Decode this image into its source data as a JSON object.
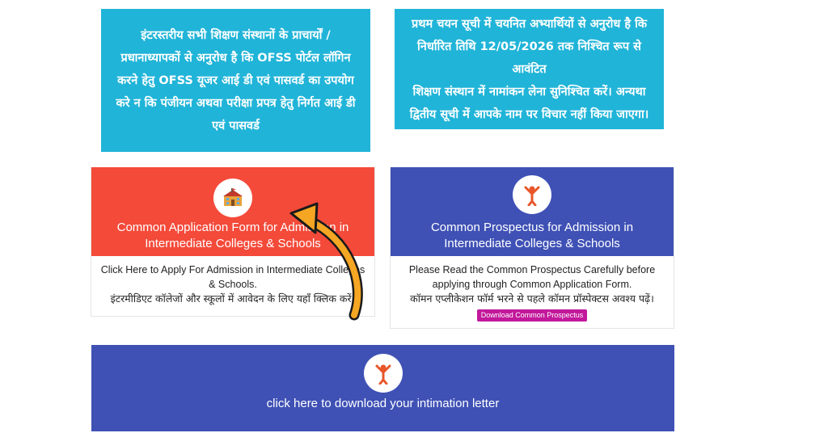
{
  "notices": {
    "left": [
      "इंटरस्तरीय सभी शिक्षण संस्थानों के प्राचार्यों /",
      "प्रधानाध्यापकों से अनुरोध है कि OFSS पोर्टल लॉगिन",
      "करने हेतु OFSS यूजर आई डी एवं पासवर्ड का उपयोग",
      "करे न कि पंजीयन अथवा परीक्षा प्रपत्र हेतु निर्गत आई डी",
      "एवं पासवर्ड"
    ],
    "right": [
      "प्रथम चयन सूची में चयनित अभ्यार्थियों से अनुरोध है कि",
      "निर्धारित तिथि 12/05/2026 तक निश्चित रूप से आवंटित",
      "शिक्षण संस्थान में नामांकन लेना सुनिश्चित करें। अन्यथा",
      "द्वितीय सूची में आपके नाम पर विचार नहीं किया जाएगा।"
    ]
  },
  "apply_card": {
    "title_line1": "Common Application Form for Admission in",
    "title_line2": "Intermediate Colleges & Schools",
    "body_en_line1": "Click Here to Apply For Admission in Intermediate Colleges",
    "body_en_line2": "& Schools.",
    "body_hi": "इंटरमीडिएट कॉलेजों और स्कूलों में आवेदन के लिए यहाँ क्लिक करें।",
    "icon": "school-building-icon"
  },
  "prospectus_card": {
    "title_line1": "Common Prospectus for Admission in",
    "title_line2": "Intermediate Colleges & Schools",
    "body_en_line1": "Please Read the Common Prospectus Carefully before",
    "body_en_line2": "applying through Common Application Form.",
    "body_hi": "कॉमन एप्लीकेशन फॉर्म भरने से पहले कॉमन प्रॉस्पेक्टस अवश्य पढ़ें।",
    "button_label": "Download Common Prospectus",
    "icon": "celebrating-person-icon"
  },
  "intimation_card": {
    "text": "click here to download your intimation letter",
    "icon": "celebrating-person-icon"
  },
  "colors": {
    "notice_bg": "#20b4d8",
    "apply_head": "#f44a3a",
    "blue_head": "#3f51b5",
    "button": "#c2189b",
    "arrow": "#f5a623"
  }
}
